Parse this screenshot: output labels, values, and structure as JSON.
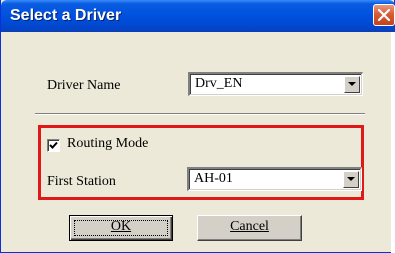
{
  "dialog": {
    "title": "Select a Driver",
    "close_icon": "close-icon"
  },
  "driver_name": {
    "label": "Driver Name",
    "value": "Drv_EN"
  },
  "routing": {
    "checkbox_checked": true,
    "label": "Routing Mode"
  },
  "first_station": {
    "label": "First Station",
    "value": "AH-01"
  },
  "buttons": {
    "ok_label": "OK",
    "cancel_label": "Cancel"
  },
  "colors": {
    "titlebar": "#0052e0",
    "highlight_border": "#e01818",
    "dialog_bg": "#ece9d8"
  }
}
